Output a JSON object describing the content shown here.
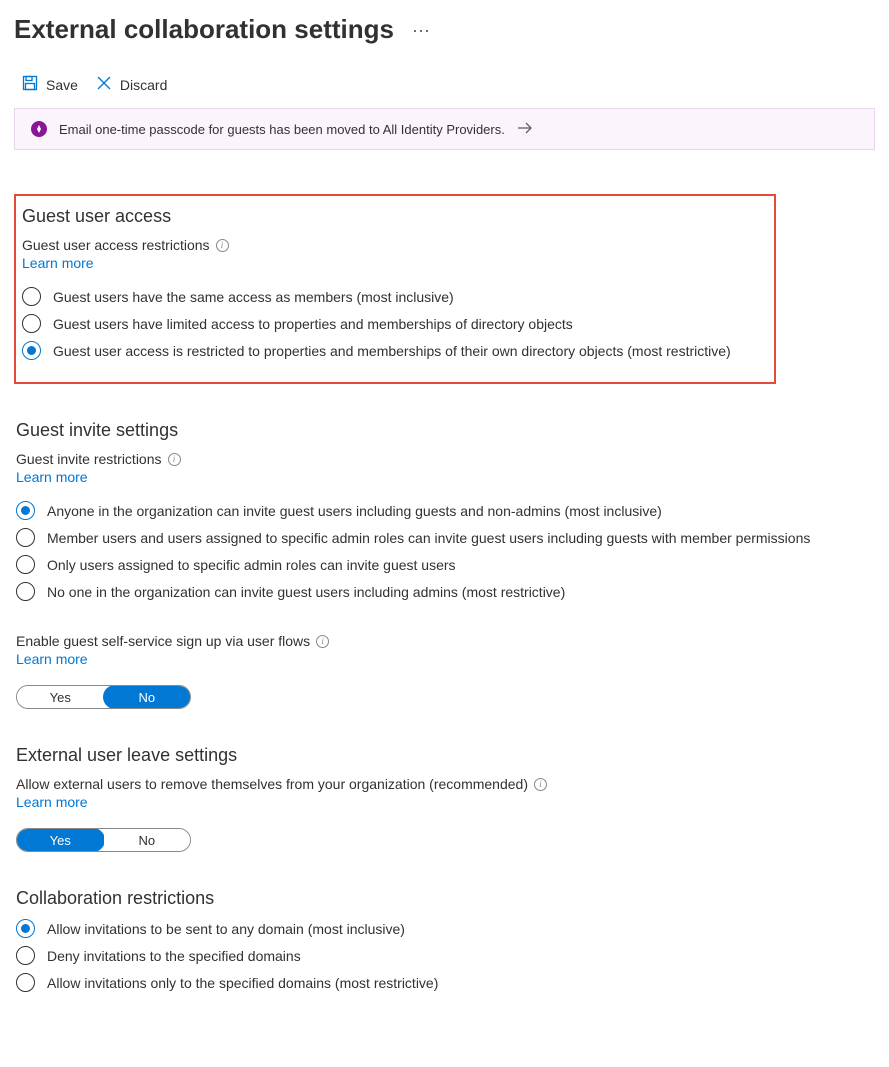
{
  "page_title": "External collaboration settings",
  "toolbar": {
    "save_label": "Save",
    "discard_label": "Discard"
  },
  "banner": {
    "text": "Email one-time passcode for guests has been moved to All Identity Providers."
  },
  "guest_access": {
    "heading": "Guest user access",
    "field_label": "Guest user access restrictions",
    "learn_more": "Learn more",
    "options": [
      "Guest users have the same access as members (most inclusive)",
      "Guest users have limited access to properties and memberships of directory objects",
      "Guest user access is restricted to properties and memberships of their own directory objects (most restrictive)"
    ],
    "selected_index": 2
  },
  "guest_invite": {
    "heading": "Guest invite settings",
    "field_label": "Guest invite restrictions",
    "learn_more": "Learn more",
    "options": [
      "Anyone in the organization can invite guest users including guests and non-admins (most inclusive)",
      "Member users and users assigned to specific admin roles can invite guest users including guests with member permissions",
      "Only users assigned to specific admin roles can invite guest users",
      "No one in the organization can invite guest users including admins (most restrictive)"
    ],
    "selected_index": 0
  },
  "self_service": {
    "field_label": "Enable guest self-service sign up via user flows",
    "learn_more": "Learn more",
    "yes": "Yes",
    "no": "No",
    "value": "No"
  },
  "external_leave": {
    "heading": "External user leave settings",
    "field_label": "Allow external users to remove themselves from your organization (recommended)",
    "learn_more": "Learn more",
    "yes": "Yes",
    "no": "No",
    "value": "Yes"
  },
  "collab_restrictions": {
    "heading": "Collaboration restrictions",
    "options": [
      "Allow invitations to be sent to any domain (most inclusive)",
      "Deny invitations to the specified domains",
      "Allow invitations only to the specified domains (most restrictive)"
    ],
    "selected_index": 0
  }
}
